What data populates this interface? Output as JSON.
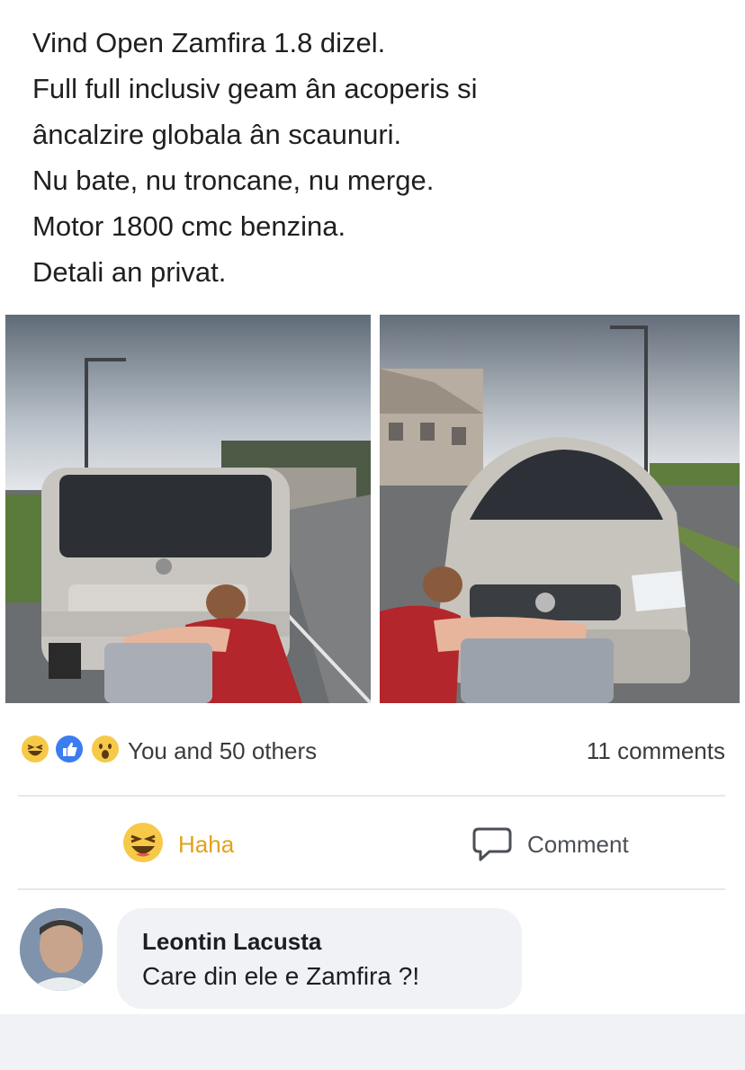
{
  "post": {
    "lines": [
      "Vind Open Zamfira  1.8 dizel.",
      "Full full inclusiv geam ân acoperis si",
      "âncalzire globala ân scaunuri.",
      "Nu bate, nu troncane, nu merge.",
      "Motor 1800 cmc benzina.",
      "Detali an privat."
    ]
  },
  "photos": {
    "left_icon": "car-rear-photo",
    "right_icon": "car-front-photo"
  },
  "reactions": {
    "icons": [
      "haha-icon",
      "like-icon",
      "wow-icon"
    ],
    "summary": "You and 50 others",
    "comments_count": "11 comments"
  },
  "actions": {
    "haha_label": "Haha",
    "comment_label": "Comment"
  },
  "comment": {
    "author": "Leontin Lacusta",
    "text": "Care din ele e Zamfira ?!"
  },
  "colors": {
    "haha": "#e0a21a",
    "like": "#3b7cf0",
    "bubble": "#f0f2f5"
  }
}
